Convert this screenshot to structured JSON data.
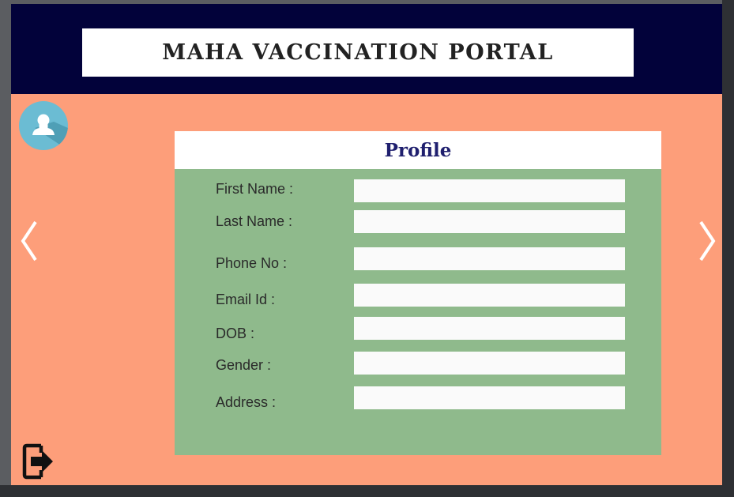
{
  "header": {
    "title": "MAHA VACCINATION PORTAL"
  },
  "profile": {
    "title": "Profile",
    "fields": [
      {
        "label": "First Name :",
        "value": ""
      },
      {
        "label": "Last Name :",
        "value": ""
      },
      {
        "label": "Phone No :",
        "value": ""
      },
      {
        "label": "Email Id :",
        "value": ""
      },
      {
        "label": "DOB :",
        "value": ""
      },
      {
        "label": "Gender :",
        "value": ""
      },
      {
        "label": "Address :",
        "value": ""
      }
    ]
  },
  "icons": {
    "avatar": "user-avatar-icon",
    "prev": "chevron-left-icon",
    "next": "chevron-right-icon",
    "logout": "logout-icon"
  },
  "colors": {
    "background": "#fd9e7a",
    "header": "#02023a",
    "card": "#8fba8c",
    "card_title": "#1f1f6e",
    "avatar": "#6bbcd3"
  }
}
